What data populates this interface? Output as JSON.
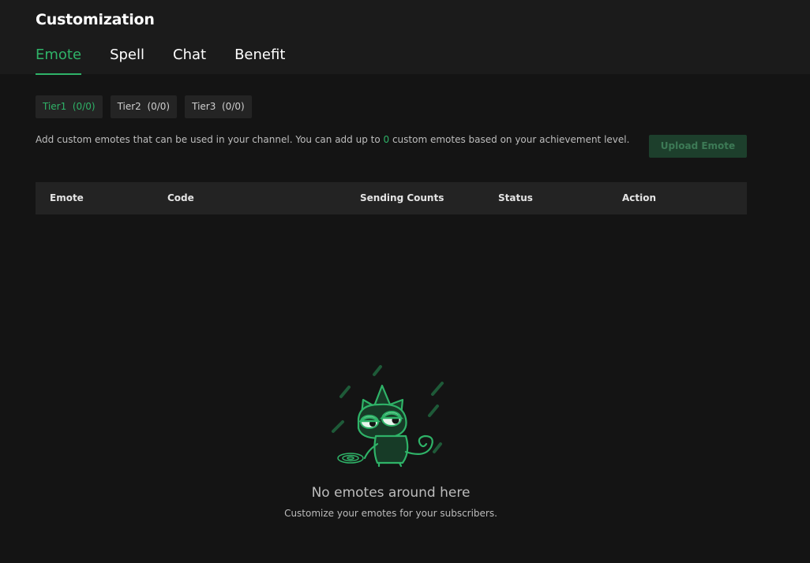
{
  "header": {
    "title": "Customization",
    "tabs": [
      {
        "label": "Emote",
        "active": true
      },
      {
        "label": "Spell",
        "active": false
      },
      {
        "label": "Chat",
        "active": false
      },
      {
        "label": "Benefit",
        "active": false
      }
    ]
  },
  "tiers": [
    {
      "label": "Tier1  (0/0)",
      "active": true
    },
    {
      "label": "Tier2  (0/0)",
      "active": false
    },
    {
      "label": "Tier3  (0/0)",
      "active": false
    }
  ],
  "description": {
    "before": "Add custom emotes that can be used in your channel. You can add up to ",
    "count": "0",
    "after": " custom emotes based on your achievement level."
  },
  "upload_button": "Upload Emote",
  "table": {
    "columns": [
      "Emote",
      "Code",
      "Sending Counts",
      "Status",
      "Action"
    ]
  },
  "empty_state": {
    "title": "No emotes around here",
    "subtitle": "Customize your emotes for your subscribers."
  },
  "colors": {
    "accent": "#2fb368",
    "background": "#141414",
    "header_bg": "#1b1b1b"
  }
}
